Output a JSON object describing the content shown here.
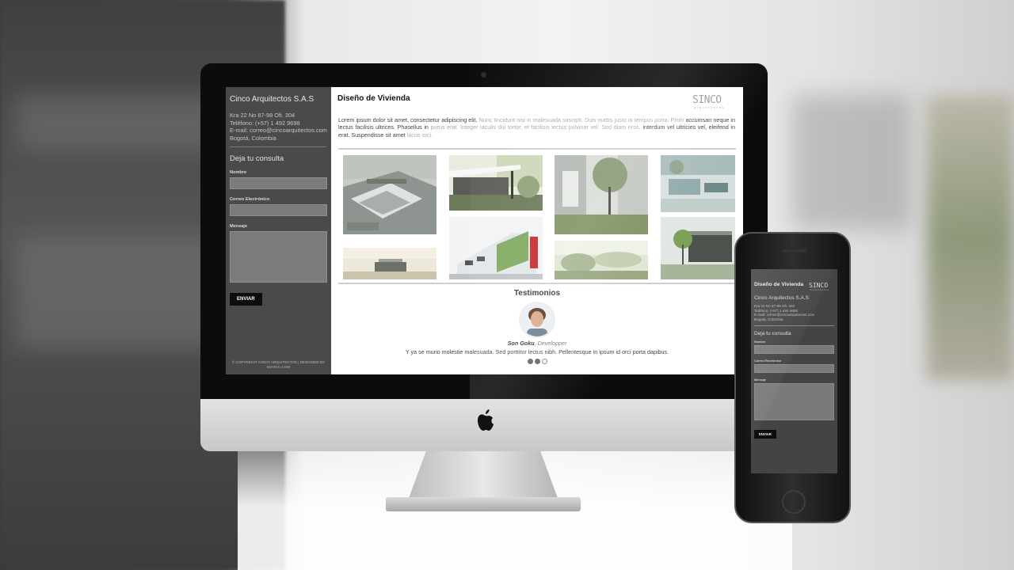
{
  "site": {
    "company": "Cinco Arquitectos S.A.S",
    "contact_lines": [
      "Kra 22 No 87-98 Ofi. 304",
      "Teléfono: (+57) 1 492 9698",
      "E-mail: correo@cincoarquitectos.com",
      "Bogotá, Colombia"
    ],
    "form": {
      "heading": "Deja tu consulta",
      "name_label": "Nombre",
      "email_label": "Correo Electrónico",
      "message_label": "Mensaje",
      "submit_label": "ENVIAR"
    },
    "footer": "© COPYRIGHT CINCO ARQUITECTOS | DESIGNED BY EGOGC.COM"
  },
  "main": {
    "title": "Diseño de Vivienda",
    "brand": "SINCO",
    "brand_sub": "arquitectos",
    "paragraph_dark": "Lorem ipsum dolor sit amet, consectetur adipiscing elit. ",
    "paragraph_light_1": "Nunc tincidunt nisi in malesuada suscipit. Duis mattis justo in tempus porta. Proin ",
    "paragraph_dark_2": "accumsan neque in lectus facilisis ultrices. Phasellus in ",
    "paragraph_light_2": "purus erat. Integer iaculis dui tortor, et facilisis lectus pulvinar vel. Sed diam eros, ",
    "paragraph_dark_3": "interdum vel ultricies vel, eleifend in erat. Suspendisse sit amet ",
    "paragraph_light_3": "lacus orci.",
    "testimonials": {
      "title": "Testimonios",
      "name": "Son Goku",
      "role": "Developper",
      "quote": "Y ya se murio molestie malesuada. Sed porttitor lectus nibh. Pellentesque in ipsum id orci porta dapibus.",
      "dots_active_count": 2,
      "dots_total": 3
    }
  },
  "colors": {
    "sidebar": "#4a4a4a",
    "input": "#7b7b7b",
    "button": "#0d0d0d"
  }
}
